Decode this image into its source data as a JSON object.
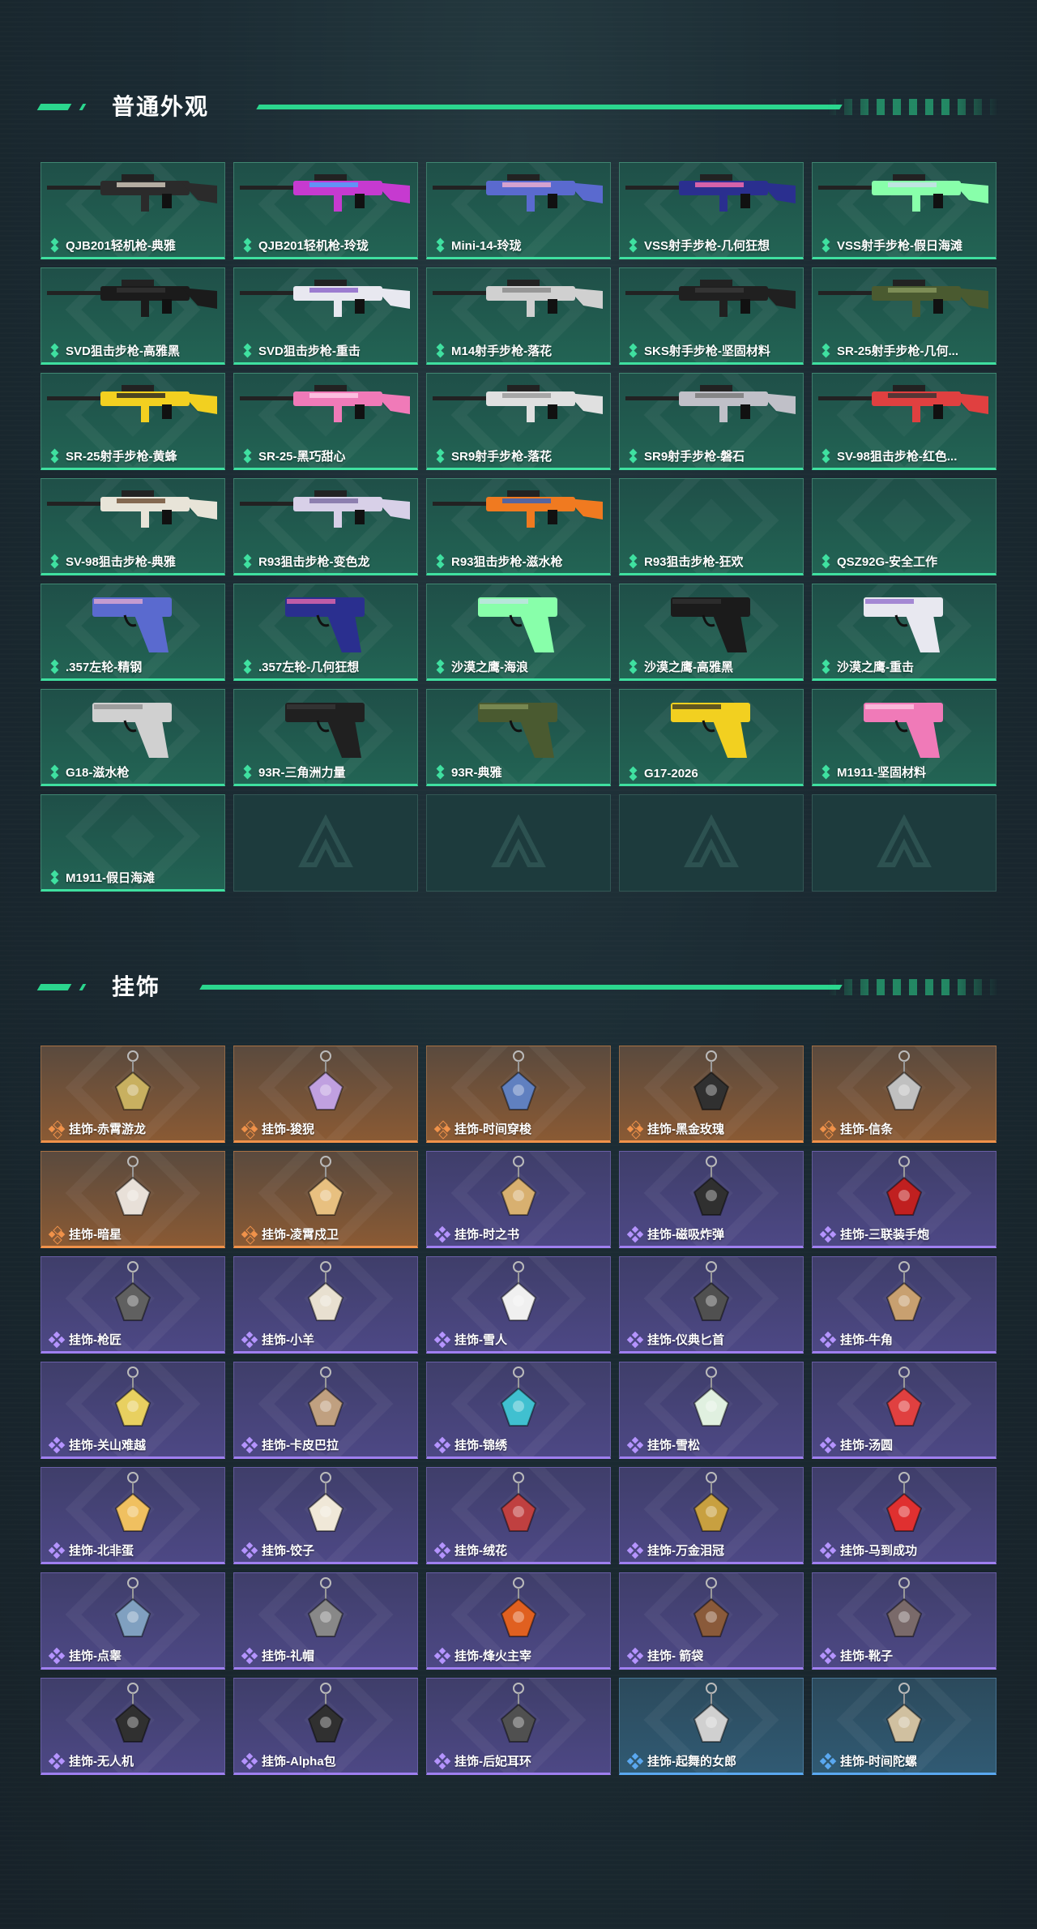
{
  "sections": {
    "skins": {
      "title": "普通外观"
    },
    "pendants": {
      "title": "挂饰"
    }
  },
  "colors": {
    "accent": "#2bd68e",
    "green_rarity": "#3fe0a0",
    "orange_rarity": "#f0924a",
    "purple_rarity": "#9f7ff0",
    "blue_rarity": "#5aa8f0"
  },
  "skins": [
    {
      "label": "QJB201轻机枪-典雅",
      "icon": "rifle-icon"
    },
    {
      "label": "QJB201轻机枪-玲珑",
      "icon": "rifle-icon"
    },
    {
      "label": "Mini-14-玲珑",
      "icon": "rifle-icon"
    },
    {
      "label": "VSS射手步枪-几何狂想",
      "icon": "rifle-icon"
    },
    {
      "label": "VSS射手步枪-假日海滩",
      "icon": "rifle-icon"
    },
    {
      "label": "SVD狙击步枪-高雅黑",
      "icon": "sniper-rifle-icon"
    },
    {
      "label": "SVD狙击步枪-重击",
      "icon": "sniper-rifle-icon"
    },
    {
      "label": "M14射手步枪-落花",
      "icon": "rifle-icon"
    },
    {
      "label": "SKS射手步枪-坚固材料",
      "icon": "rifle-icon"
    },
    {
      "label": "SR-25射手步枪-几何...",
      "icon": "rifle-icon"
    },
    {
      "label": "SR-25射手步枪-黄蜂",
      "icon": "rifle-icon"
    },
    {
      "label": "SR-25-黑巧甜心",
      "icon": "rifle-icon"
    },
    {
      "label": "SR9射手步枪-落花",
      "icon": "rifle-icon"
    },
    {
      "label": "SR9射手步枪-磐石",
      "icon": "rifle-icon"
    },
    {
      "label": "SV-98狙击步枪-红色...",
      "icon": "sniper-rifle-icon"
    },
    {
      "label": "SV-98狙击步枪-典雅",
      "icon": "sniper-rifle-icon"
    },
    {
      "label": "R93狙击步枪-变色龙",
      "icon": "sniper-rifle-icon"
    },
    {
      "label": "R93狙击步枪-滋水枪",
      "icon": "sniper-rifle-icon"
    },
    {
      "label": "R93狙击步枪-狂欢",
      "icon": ""
    },
    {
      "label": "QSZ92G-安全工作",
      "icon": ""
    },
    {
      "label": ".357左轮-精钢",
      "icon": "revolver-icon"
    },
    {
      "label": ".357左轮-几何狂想",
      "icon": "revolver-icon"
    },
    {
      "label": "沙漠之鹰-海浪",
      "icon": "pistol-icon"
    },
    {
      "label": "沙漠之鹰-高雅黑",
      "icon": "pistol-icon"
    },
    {
      "label": "沙漠之鹰-重击",
      "icon": "pistol-icon"
    },
    {
      "label": "G18-滋水枪",
      "icon": "pistol-icon"
    },
    {
      "label": "93R-三角洲力量",
      "icon": "pistol-icon"
    },
    {
      "label": "93R-典雅",
      "icon": "pistol-icon"
    },
    {
      "label": "G17-2026",
      "icon": "pistol-icon"
    },
    {
      "label": "M1911-坚固材料",
      "icon": "pistol-icon"
    },
    {
      "label": "M1911-假日海滩",
      "icon": ""
    }
  ],
  "pendants": [
    {
      "label": "挂饰-赤霄游龙",
      "rarity": "orange"
    },
    {
      "label": "挂饰-狻猊",
      "rarity": "orange"
    },
    {
      "label": "挂饰-时间穿梭",
      "rarity": "orange"
    },
    {
      "label": "挂饰-黑金玫瑰",
      "rarity": "orange"
    },
    {
      "label": "挂饰-信条",
      "rarity": "orange"
    },
    {
      "label": "挂饰-暗星",
      "rarity": "orange"
    },
    {
      "label": "挂饰-凌霄戍卫",
      "rarity": "orange"
    },
    {
      "label": "挂饰-时之书",
      "rarity": "purple"
    },
    {
      "label": "挂饰-磁吸炸弹",
      "rarity": "purple"
    },
    {
      "label": "挂饰-三联装手炮",
      "rarity": "purple"
    },
    {
      "label": "挂饰-枪匠",
      "rarity": "purple"
    },
    {
      "label": "挂饰-小羊",
      "rarity": "purple"
    },
    {
      "label": "挂饰-雪人",
      "rarity": "purple"
    },
    {
      "label": "挂饰-仪典匕首",
      "rarity": "purple"
    },
    {
      "label": "挂饰-牛角",
      "rarity": "purple"
    },
    {
      "label": "挂饰-关山难越",
      "rarity": "purple"
    },
    {
      "label": "挂饰-卡皮巴拉",
      "rarity": "purple"
    },
    {
      "label": "挂饰-锦绣",
      "rarity": "purple"
    },
    {
      "label": "挂饰-雪松",
      "rarity": "purple"
    },
    {
      "label": "挂饰-汤圆",
      "rarity": "purple"
    },
    {
      "label": "挂饰-北非蛋",
      "rarity": "purple"
    },
    {
      "label": "挂饰-饺子",
      "rarity": "purple"
    },
    {
      "label": "挂饰-绒花",
      "rarity": "purple"
    },
    {
      "label": "挂饰-万金泪冠",
      "rarity": "purple"
    },
    {
      "label": "挂饰-马到成功",
      "rarity": "purple"
    },
    {
      "label": "挂饰-点睾",
      "rarity": "purple"
    },
    {
      "label": "挂饰-礼帽",
      "rarity": "purple"
    },
    {
      "label": "挂饰-烽火主宰",
      "rarity": "purple"
    },
    {
      "label": "挂饰- 箭袋",
      "rarity": "purple"
    },
    {
      "label": "挂饰-靴子",
      "rarity": "purple"
    },
    {
      "label": "挂饰-无人机",
      "rarity": "purple"
    },
    {
      "label": "挂饰-Alpha包",
      "rarity": "purple"
    },
    {
      "label": "挂饰-后妃耳环",
      "rarity": "purple"
    },
    {
      "label": "挂饰-起舞的女郎",
      "rarity": "blue"
    },
    {
      "label": "挂饰-时间陀螺",
      "rarity": "blue"
    }
  ]
}
